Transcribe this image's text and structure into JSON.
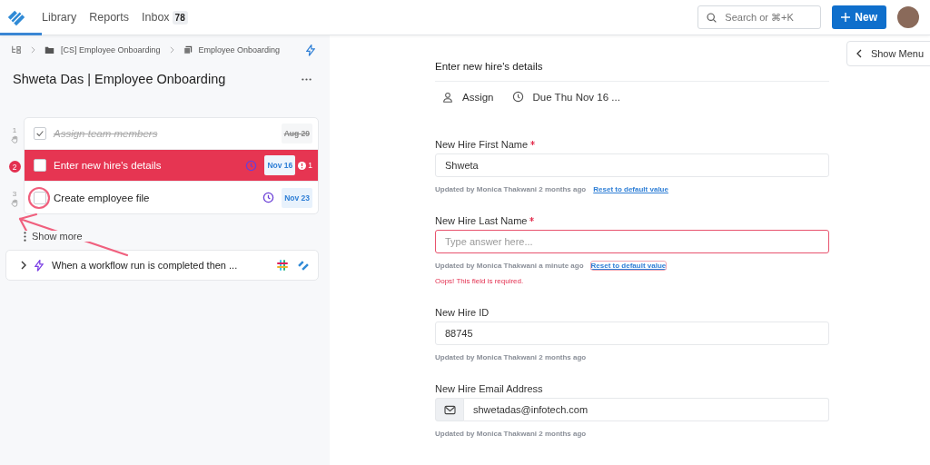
{
  "nav": {
    "links": [
      {
        "label": "Library"
      },
      {
        "label": "Reports"
      },
      {
        "label": "Inbox",
        "badge": "78"
      }
    ],
    "search": {
      "placeholder": "Search or ⌘+K"
    },
    "new_button": "New"
  },
  "breadcrumb": [
    "[CS] Employee Onboarding",
    "Employee Onboarding"
  ],
  "run_title": "Shweta Das | Employee Onboarding",
  "tasks": [
    {
      "number": "1",
      "title": "Assign team members",
      "due": "Aug 29",
      "checked": true,
      "selected": false
    },
    {
      "number": "2",
      "title": "Enter new hire's details",
      "due": "Nov 16",
      "checked": false,
      "selected": true,
      "error_count": "1"
    },
    {
      "number": "3",
      "title": "Create employee file",
      "due": "Nov 23",
      "checked": false,
      "selected": false
    }
  ],
  "show_more": "Show more",
  "automation": "When a workflow run is completed then ...",
  "show_menu": "Show Menu",
  "task_heading": "Enter new hire's details",
  "assign": "Assign",
  "due": "Due Thu Nov 16 ...",
  "fields": [
    {
      "kind": "text",
      "label": "New Hire First Name",
      "required": true,
      "value": "Shweta",
      "updated": "Updated by Monica Thakwani 2 months ago",
      "reset": "Reset to default value"
    },
    {
      "kind": "text",
      "label": "New Hire Last Name",
      "required": true,
      "placeholder": "Type answer here...",
      "updated": "Updated by Monica Thakwani a minute ago",
      "reset": "Reset to default value",
      "error": "Oops! This field is required."
    },
    {
      "kind": "text",
      "label": "New Hire ID",
      "required": false,
      "value": "88745",
      "updated": "Updated by Monica Thakwani 2 months ago"
    },
    {
      "kind": "email",
      "label": "New Hire Email Address",
      "required": false,
      "value": "shwetadas@infotech.com",
      "updated": "Updated by Monica Thakwani 2 months ago"
    }
  ]
}
